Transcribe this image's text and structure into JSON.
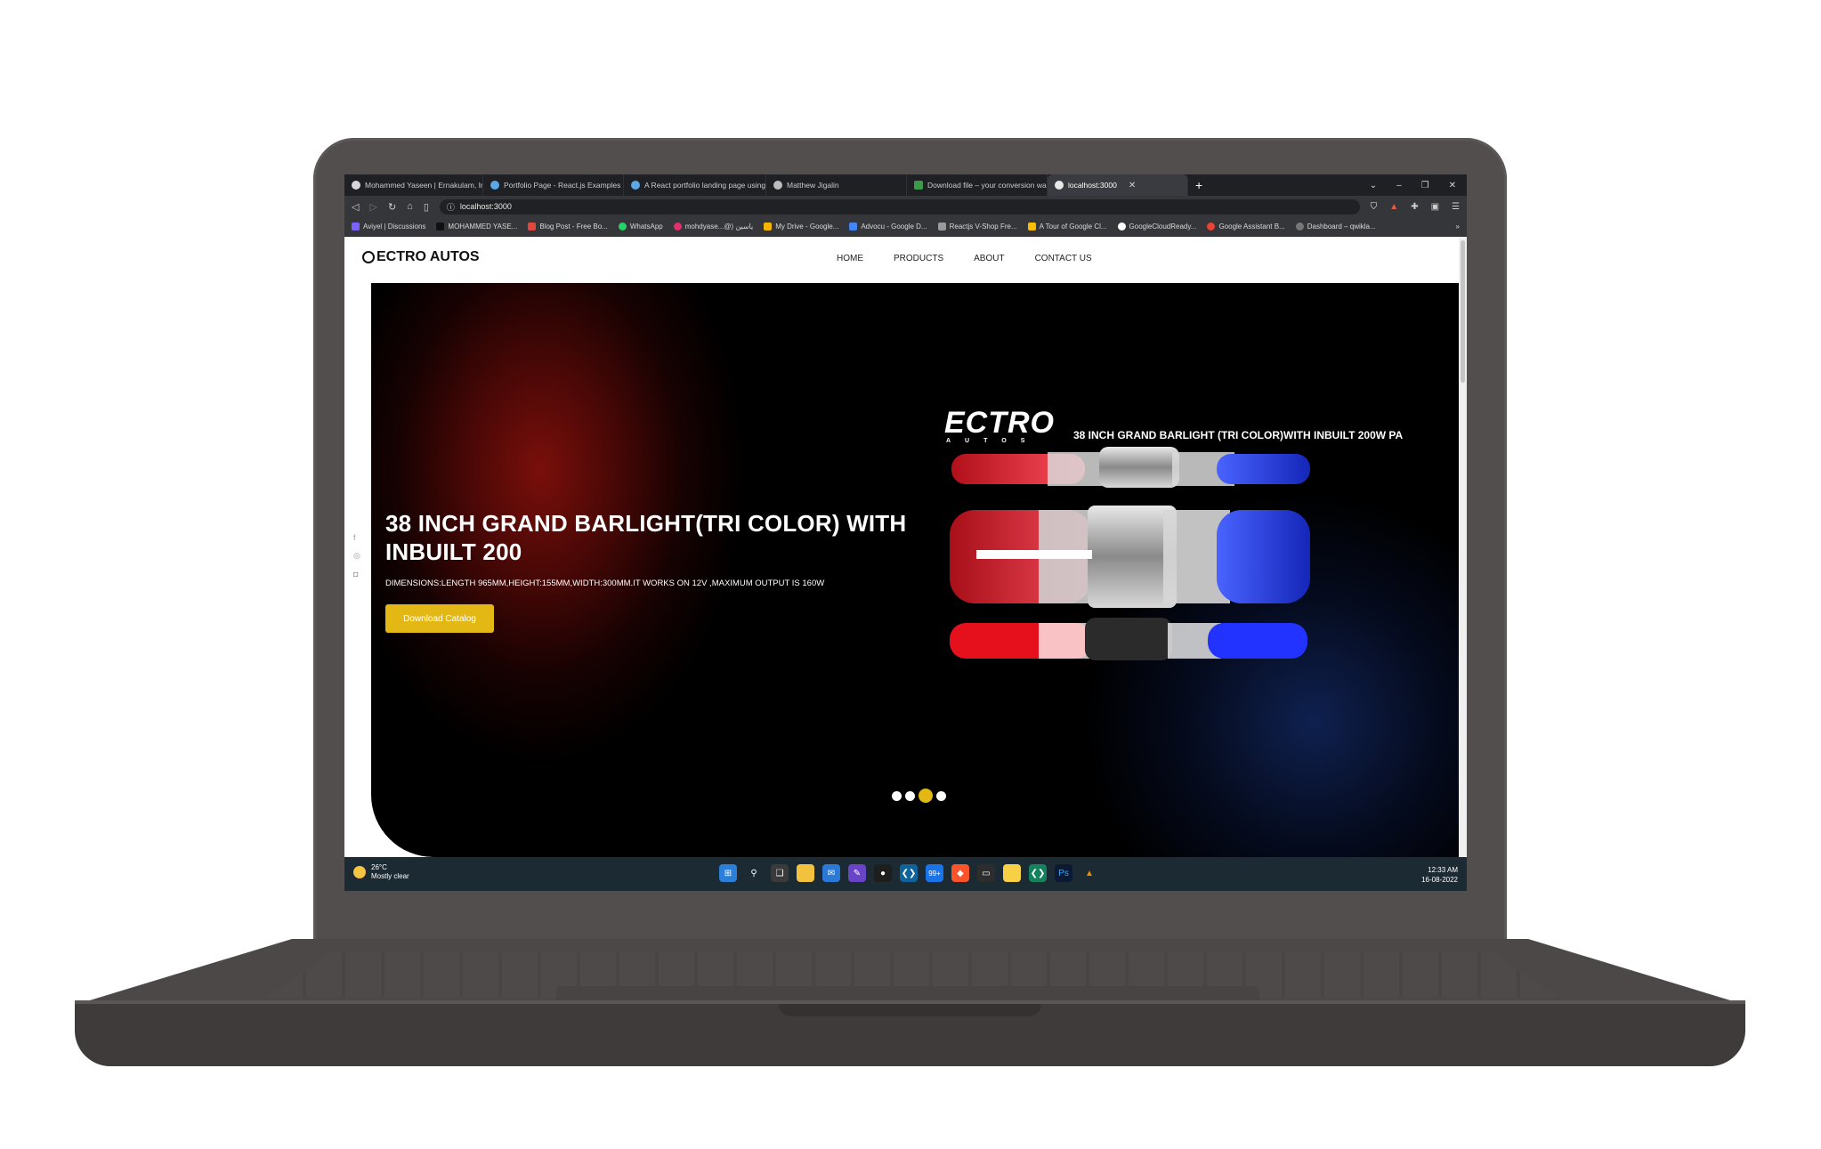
{
  "browser": {
    "tabs": [
      {
        "label": "Mohammed Yaseen | Ernakulam, India",
        "active": false
      },
      {
        "label": "Portfolio Page - React.js Examples",
        "active": false
      },
      {
        "label": "A React portfolio landing page using",
        "active": false
      },
      {
        "label": "Matthew Jigalin",
        "active": false
      },
      {
        "label": "Download file – your conversion was",
        "active": false
      },
      {
        "label": "localhost:3000",
        "active": true
      }
    ],
    "new_tab": "+",
    "url": "localhost:3000",
    "bookmarks": [
      "Aviyel | Discussions",
      "MOHAMMED YASE...",
      "Blog Post - Free Bo...",
      "WhatsApp",
      "mohdyase...@) ياسين",
      "My Drive - Google...",
      "Advocu - Google D...",
      "Reactjs V-Shop Fre...",
      "A Tour of Google Cl...",
      "GoogleCloudReady...",
      "Google Assistant B...",
      "Dashboard – qwikla..."
    ],
    "bookmarks_more": "»"
  },
  "site": {
    "logo": "ECTRO AUTOS",
    "nav": [
      "HOME",
      "PRODUCTS",
      "ABOUT",
      "CONTACT US"
    ],
    "hero": {
      "title": "38 INCH GRAND BARLIGHT(TRI COLOR) WITH INBUILT 200",
      "description": "DIMENSIONS:LENGTH 965MM,HEIGHT:155MM,WIDTH:300MM.IT WORKS ON 12V ,MAXIMUM OUTPUT IS 160W",
      "button": "Download Catalog",
      "product_logo": "ECTRO",
      "product_logo_sub": "AUTOS",
      "product_title": "38 INCH GRAND BARLIGHT (TRI COLOR)WITH INBUILT 200W PA",
      "slides": 4,
      "active_slide": 3
    },
    "social": [
      "f",
      "◎",
      "◘"
    ]
  },
  "taskbar": {
    "temp": "26°C",
    "weather": "Mostly clear",
    "time": "12:33 AM",
    "date": "16-08-2022",
    "badge": "99+"
  },
  "colors": {
    "accent": "#e3b814",
    "hero_bg": "#000000",
    "taskbar": "#1c2a33",
    "laptop": "#524e4d"
  }
}
